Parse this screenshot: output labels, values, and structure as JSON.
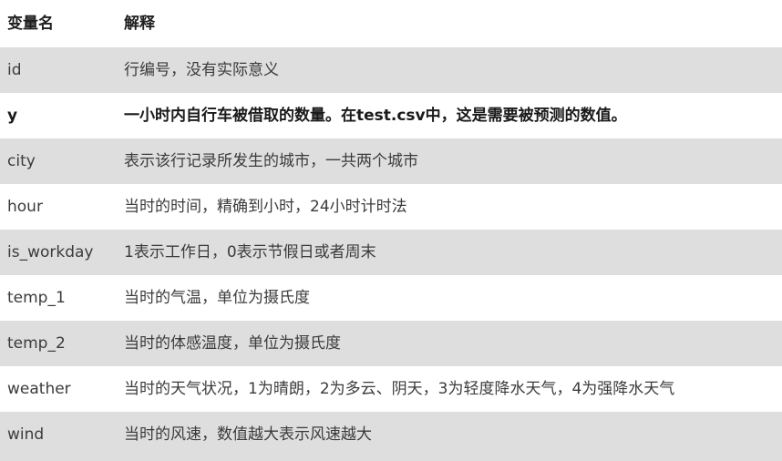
{
  "table": {
    "headers": {
      "name": "变量名",
      "description": "解释"
    },
    "rows": [
      {
        "name": "id",
        "description": "行编号，没有实际意义",
        "emphasis": false
      },
      {
        "name": "y",
        "description": "一小时内自行车被借取的数量。在test.csv中，这是需要被预测的数值。",
        "emphasis": true
      },
      {
        "name": "city",
        "description": "表示该行记录所发生的城市，一共两个城市",
        "emphasis": false
      },
      {
        "name": "hour",
        "description": "当时的时间，精确到小时，24小时计时法",
        "emphasis": false
      },
      {
        "name": "is_workday",
        "description": "1表示工作日，0表示节假日或者周末",
        "emphasis": false
      },
      {
        "name": "temp_1",
        "description": "当时的气温，单位为摄氏度",
        "emphasis": false
      },
      {
        "name": "temp_2",
        "description": "当时的体感温度，单位为摄氏度",
        "emphasis": false
      },
      {
        "name": "weather",
        "description": "当时的天气状况，1为晴朗，2为多云、阴天，3为轻度降水天气，4为强降水天气",
        "emphasis": false
      },
      {
        "name": "wind",
        "description": "当时的风速，数值越大表示风速越大",
        "emphasis": false
      }
    ]
  },
  "colors": {
    "row_stripe": "#dedede",
    "row_plain": "#ffffff",
    "text": "#3b3b3b",
    "header_text": "#1f1f1f"
  }
}
